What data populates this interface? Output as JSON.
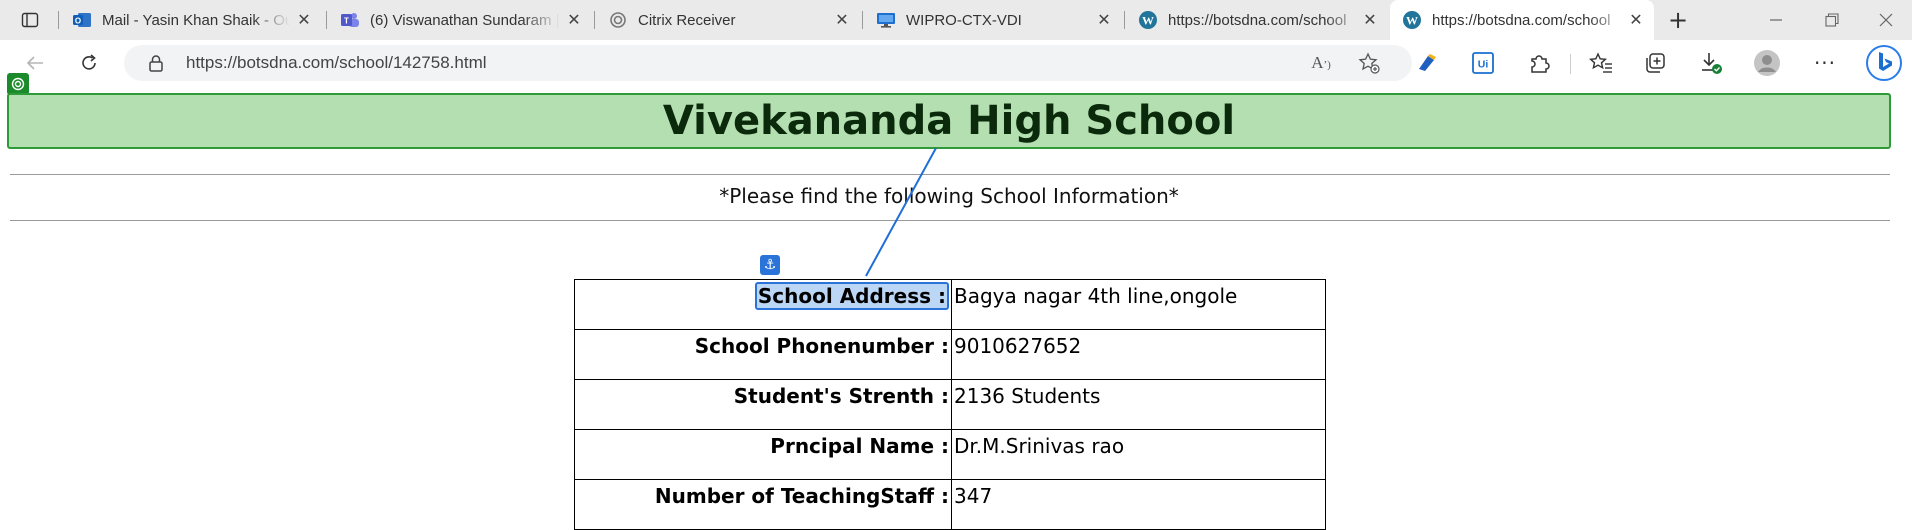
{
  "browser": {
    "tabs": [
      {
        "title": "Mail - Yasin Khan Shaik - Ou",
        "icon": "outlook-icon"
      },
      {
        "title": "(6) Viswanathan Sundaram |",
        "icon": "teams-icon"
      },
      {
        "title": "Citrix Receiver",
        "icon": "citrix-icon"
      },
      {
        "title": "WIPRO-CTX-VDI",
        "icon": "monitor-icon"
      },
      {
        "title": "https://botsdna.com/school",
        "icon": "wordpress-icon"
      },
      {
        "title": "https://botsdna.com/school",
        "icon": "wordpress-icon"
      }
    ],
    "active_tab_index": 5,
    "url": "https://botsdna.com/school/142758.html",
    "accent_color": "#1a73e8"
  },
  "page": {
    "school_name": "Vivekananda High School",
    "subtitle": "*Please find the following School Information*",
    "info": [
      {
        "label": "School Address :",
        "value": "Bagya nagar 4th line,ongole"
      },
      {
        "label": "School Phonenumber :",
        "value": "9010627652"
      },
      {
        "label": "Student's Strenth :",
        "value": "2136 Students"
      },
      {
        "label": "Prncipal Name :",
        "value": "Dr.M.Srinivas rao"
      },
      {
        "label": "Number of TeachingStaff :",
        "value": "347"
      }
    ],
    "title_bg_color": "#b3dfb1",
    "selection_color": "#2a73d9"
  }
}
